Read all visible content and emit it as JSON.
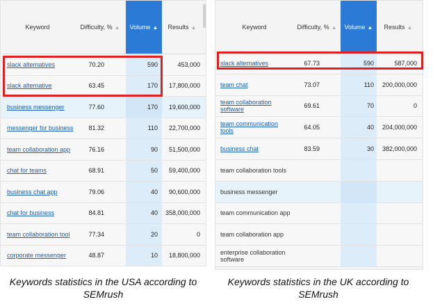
{
  "left": {
    "headers": {
      "keyword": "Keyword",
      "difficulty": "Difficulty, %",
      "volume": "Volume",
      "results": "Results"
    },
    "rows": [
      {
        "keyword": "slack alternatives",
        "difficulty": "70.20",
        "volume": "590",
        "results": "453,000",
        "highlight": false
      },
      {
        "keyword": "slack alternative",
        "difficulty": "63.45",
        "volume": "170",
        "results": "17,800,000",
        "highlight": false
      },
      {
        "keyword": "business messenger",
        "difficulty": "77.60",
        "volume": "170",
        "results": "19,600,000",
        "highlight": true
      },
      {
        "keyword": "messenger for business",
        "difficulty": "81.32",
        "volume": "110",
        "results": "22,700,000",
        "highlight": false
      },
      {
        "keyword": "team collaboration app",
        "difficulty": "76.16",
        "volume": "90",
        "results": "51,500,000",
        "highlight": false
      },
      {
        "keyword": "chat for teams",
        "difficulty": "68.91",
        "volume": "50",
        "results": "59,400,000",
        "highlight": false
      },
      {
        "keyword": "business chat app",
        "difficulty": "79.06",
        "volume": "40",
        "results": "90,600,000",
        "highlight": false
      },
      {
        "keyword": "chat for business",
        "difficulty": "84.81",
        "volume": "40",
        "results": "358,000,000",
        "highlight": false
      },
      {
        "keyword": "team collaboration tool",
        "difficulty": "77.34",
        "volume": "20",
        "results": "0",
        "highlight": false
      },
      {
        "keyword": "corporate messenger",
        "difficulty": "48.87",
        "volume": "10",
        "results": "18,800,000",
        "highlight": false
      }
    ],
    "caption_line1": "Keywords statistics in the USA according to",
    "caption_line2": "SEMrush"
  },
  "right": {
    "headers": {
      "keyword": "Keyword",
      "difficulty": "Difficulty, %",
      "volume": "Volume",
      "results": "Results"
    },
    "rows": [
      {
        "keyword": "slack alternatives",
        "difficulty": "67.73",
        "volume": "590",
        "results": "587,000",
        "highlight": false,
        "link": true
      },
      {
        "keyword": "team chat",
        "difficulty": "73.07",
        "volume": "110",
        "results": "200,000,000",
        "highlight": false,
        "link": true
      },
      {
        "keyword": "team collaboration software",
        "difficulty": "69.61",
        "volume": "70",
        "results": "0",
        "highlight": false,
        "link": true
      },
      {
        "keyword": "team communication tools",
        "difficulty": "64.05",
        "volume": "40",
        "results": "204,000,000",
        "highlight": false,
        "link": true
      },
      {
        "keyword": "business chat",
        "difficulty": "83.59",
        "volume": "30",
        "results": "382,000,000",
        "highlight": false,
        "link": true
      },
      {
        "keyword": "team collaboration tools",
        "difficulty": "",
        "volume": "",
        "results": "",
        "highlight": false,
        "link": false
      },
      {
        "keyword": "business messenger",
        "difficulty": "",
        "volume": "",
        "results": "",
        "highlight": true,
        "link": false
      },
      {
        "keyword": "team communication app",
        "difficulty": "",
        "volume": "",
        "results": "",
        "highlight": false,
        "link": false
      },
      {
        "keyword": "team collaboration app",
        "difficulty": "",
        "volume": "",
        "results": "",
        "highlight": false,
        "link": false
      },
      {
        "keyword": "enterprise collaboration software",
        "difficulty": "",
        "volume": "",
        "results": "",
        "highlight": false,
        "link": false
      }
    ],
    "caption_line1": "Keywords statistics in the UK according to",
    "caption_line2": "SEMrush"
  },
  "colors": {
    "accent": "#2b7bd6",
    "link": "#1a5fb4",
    "highlight_box": "#e02020"
  }
}
